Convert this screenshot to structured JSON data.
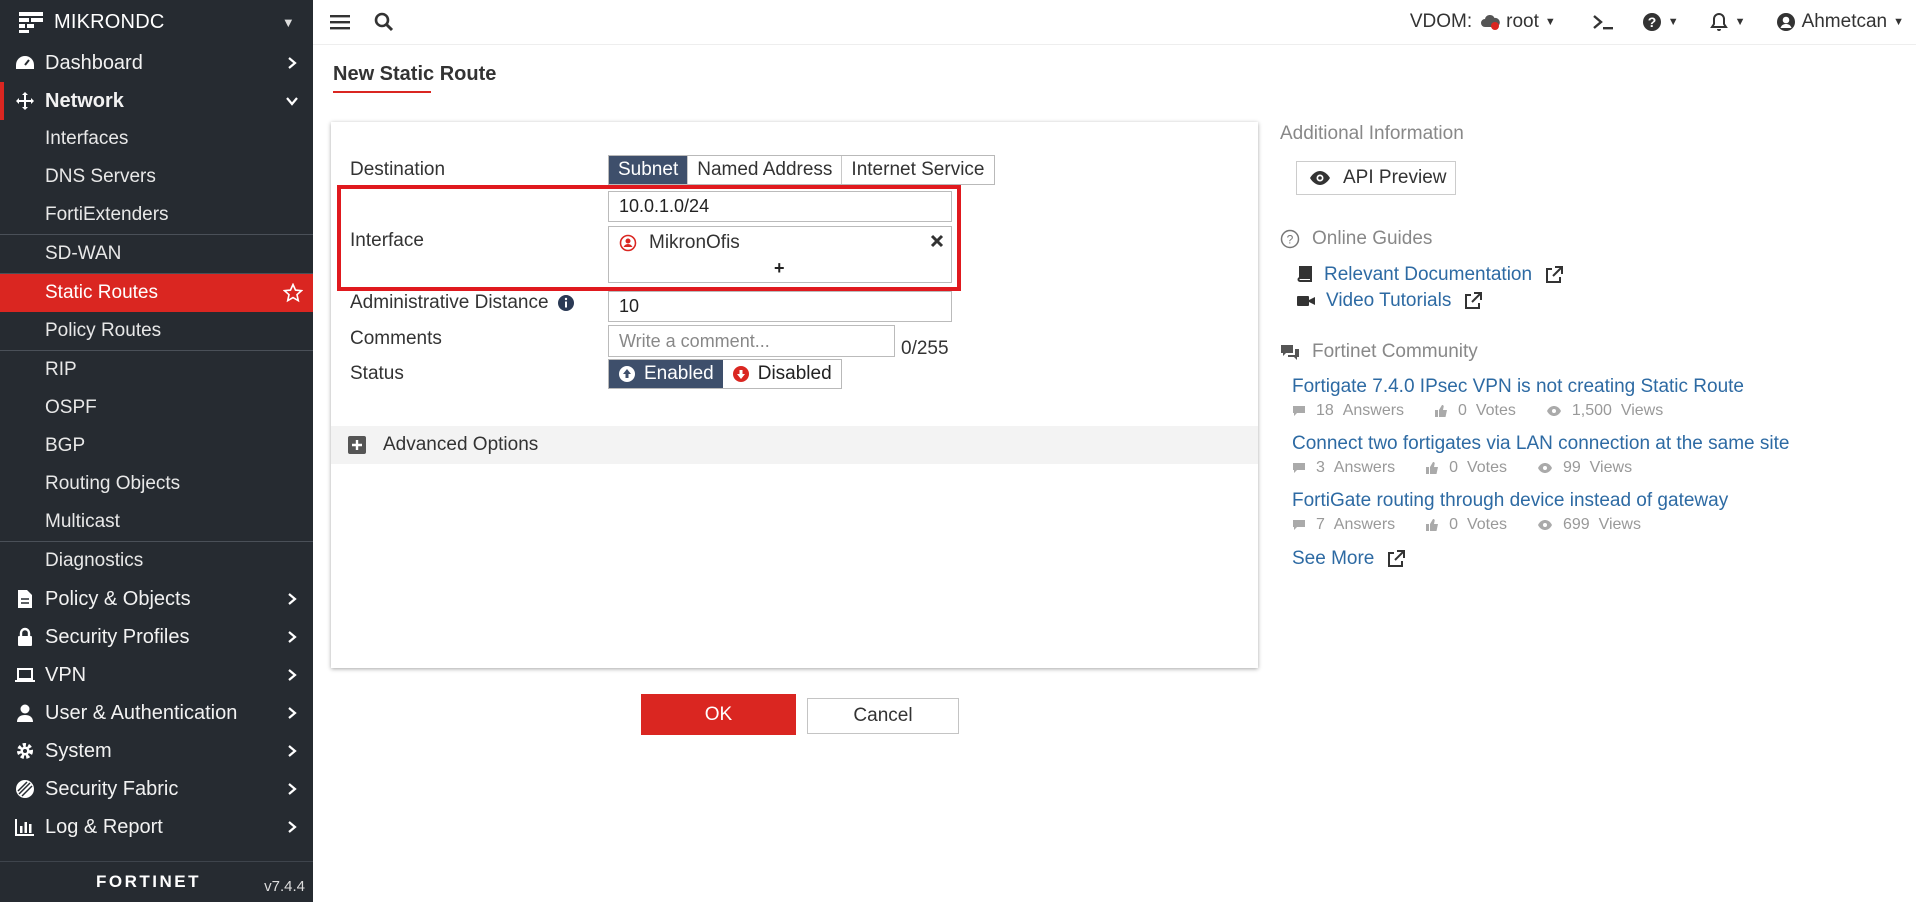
{
  "sidebar": {
    "device_name": "MIKRONDC",
    "items": [
      {
        "label": "Dashboard",
        "icon": "dashboard-icon"
      },
      {
        "label": "Network",
        "icon": "network-icon"
      },
      {
        "label": "Policy & Objects",
        "icon": "policy-icon"
      },
      {
        "label": "Security Profiles",
        "icon": "lock-icon"
      },
      {
        "label": "VPN",
        "icon": "laptop-icon"
      },
      {
        "label": "User & Authentication",
        "icon": "user-icon"
      },
      {
        "label": "System",
        "icon": "gear-icon"
      },
      {
        "label": "Security Fabric",
        "icon": "fabric-icon"
      },
      {
        "label": "Log & Report",
        "icon": "chart-icon"
      }
    ],
    "network_sub": [
      "Interfaces",
      "DNS Servers",
      "FortiExtenders",
      "SD-WAN",
      "Static Routes",
      "Policy Routes",
      "RIP",
      "OSPF",
      "BGP",
      "Routing Objects",
      "Multicast",
      "Diagnostics"
    ],
    "brand": "FORTINET",
    "version": "v7.4.4"
  },
  "topbar": {
    "vdom_label": "VDOM:",
    "vdom_value": "root",
    "user": "Ahmetcan"
  },
  "page": {
    "title": "New Static Route"
  },
  "form": {
    "destination_label": "Destination",
    "destination_options": [
      "Subnet",
      "Named Address",
      "Internet Service"
    ],
    "destination_value": "10.0.1.0/24",
    "interface_label": "Interface",
    "interface_value": "MikronOfis",
    "add_symbol": "+",
    "admin_distance_label": "Administrative Distance",
    "admin_distance_value": "10",
    "comments_label": "Comments",
    "comments_placeholder": "Write a comment...",
    "comments_counter": "0/255",
    "status_label": "Status",
    "status_enabled": "Enabled",
    "status_disabled": "Disabled",
    "advanced_label": "Advanced Options"
  },
  "buttons": {
    "ok": "OK",
    "cancel": "Cancel"
  },
  "info": {
    "additional_title": "Additional Information",
    "api_preview": "API Preview",
    "online_guides_title": "Online Guides",
    "relevant_docs": "Relevant Documentation",
    "video_tutorials": "Video Tutorials",
    "community_title": "Fortinet Community",
    "posts": [
      {
        "title": "Fortigate 7.4.0 IPsec VPN is not creating Static Route",
        "answers": "18",
        "votes": "0",
        "views": "1,500"
      },
      {
        "title": "Connect two fortigates via LAN connection at the same site",
        "answers": "3",
        "votes": "0",
        "views": "99"
      },
      {
        "title": "FortiGate routing through device instead of gateway",
        "answers": "7",
        "votes": "0",
        "views": "699"
      }
    ],
    "answers_word": "Answers",
    "votes_word": "Votes",
    "views_word": "Views",
    "see_more": "See More"
  },
  "colors": {
    "accent_red": "#da2621",
    "sidebar_bg": "#262b31",
    "segment_on": "#3e4f6b",
    "link_blue": "#2d6aa3"
  }
}
